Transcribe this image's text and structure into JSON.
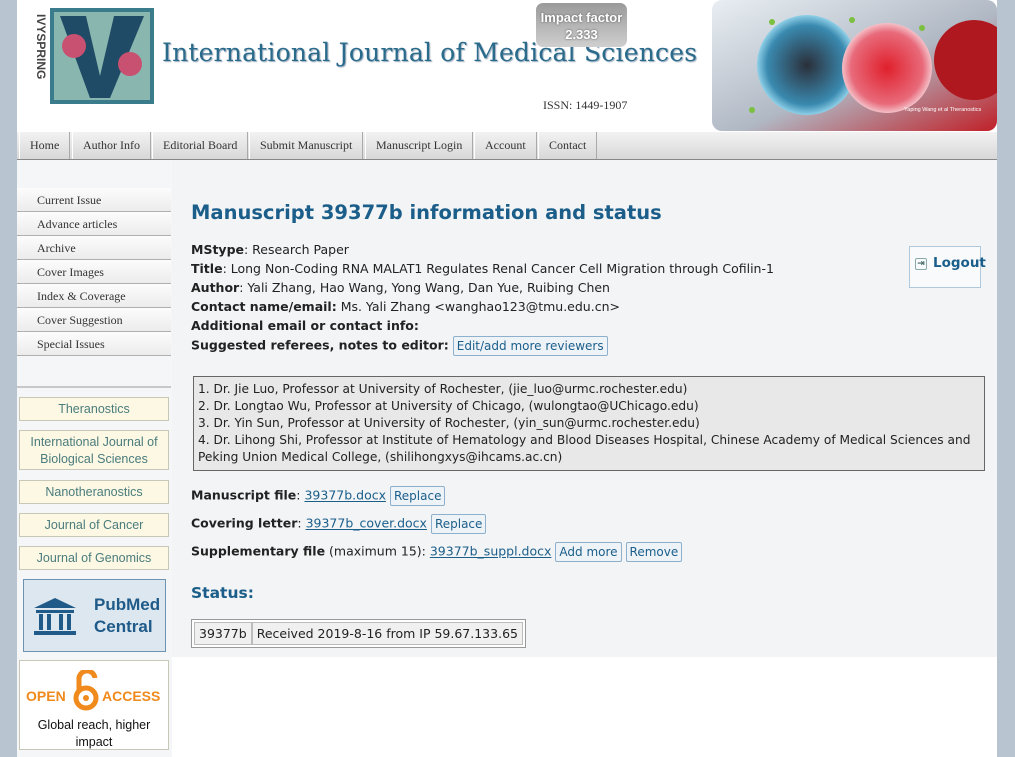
{
  "header": {
    "logo_text": "IVYSPRING",
    "journal_title": "International Journal of Medical Sciences",
    "impact_label": "Impact factor",
    "impact_value": "2.333",
    "issn": "ISSN: 1449-1907",
    "cover_credit": "Yaping Wang et al Theranostics"
  },
  "nav": {
    "items": [
      "Home",
      "Author Info",
      "Editorial Board",
      "Submit Manuscript",
      "Manuscript Login",
      "Account",
      "Contact"
    ]
  },
  "sidebar": {
    "links": [
      "Current Issue",
      "Advance articles",
      "Archive",
      "Cover Images",
      "Index & Coverage",
      "Cover Suggestion",
      "Special Issues"
    ],
    "journals": [
      "Theranostics",
      "International Journal of Biological Sciences",
      "Nanotheranostics",
      "Journal of Cancer",
      "Journal of Genomics"
    ],
    "pmc_line1": "PubMed",
    "pmc_line2": "Central",
    "oa_word1": "OPEN",
    "oa_word2": "ACCESS",
    "oa_caption": "Global reach, higher impact"
  },
  "main": {
    "title": "Manuscript 39377b information and status",
    "mstype_label": "MStype",
    "mstype_value": ": Research Paper",
    "title_label": "Title",
    "title_value": ": Long Non-Coding RNA MALAT1 Regulates Renal Cancer Cell Migration through Cofilin-1",
    "author_label": "Author",
    "author_value": ": Yali Zhang, Hao Wang, Yong Wang, Dan Yue, Ruibing Chen",
    "contact_label": "Contact name/email:",
    "contact_value": " Ms. Yali Zhang <wanghao123@tmu.edu.cn>",
    "additional_label": "Additional email or contact info:",
    "referees_label": "Suggested referees, notes to editor:",
    "referees_button": "Edit/add more reviewers",
    "referees": [
      "1. Dr. Jie Luo, Professor at University of Rochester, (jie_luo@urmc.rochester.edu)",
      "2. Dr. Longtao Wu, Professor at University of Chicago, (wulongtao@UChicago.edu)",
      "3. Dr. Yin Sun, Professor at University of Rochester, (yin_sun@urmc.rochester.edu)",
      "4. Dr. Lihong Shi, Professor at Institute of Hematology and Blood Diseases Hospital, Chinese Academy of Medical Sciences and Peking Union Medical College, (shilihongxys@ihcams.ac.cn)"
    ],
    "manuscript_label": "Manuscript file",
    "manuscript_file": "39377b.docx",
    "manuscript_replace": "Replace",
    "cover_label": "Covering letter",
    "cover_file": "39377b_cover.docx",
    "cover_replace": "Replace",
    "supp_label": "Supplementary file",
    "supp_note": " (maximum 15): ",
    "supp_file": "39377b_suppl.docx",
    "supp_add": "Add more",
    "supp_remove": "Remove",
    "logout": "Logout",
    "status_title": "Status:",
    "status_id": "39377b",
    "status_text": "Received 2019-8-16 from IP 59.67.133.65"
  },
  "colors": {
    "accent": "#1b5e8a",
    "journal_box_bg": "#fcf8e4",
    "main_bg": "#f2f4f5"
  }
}
